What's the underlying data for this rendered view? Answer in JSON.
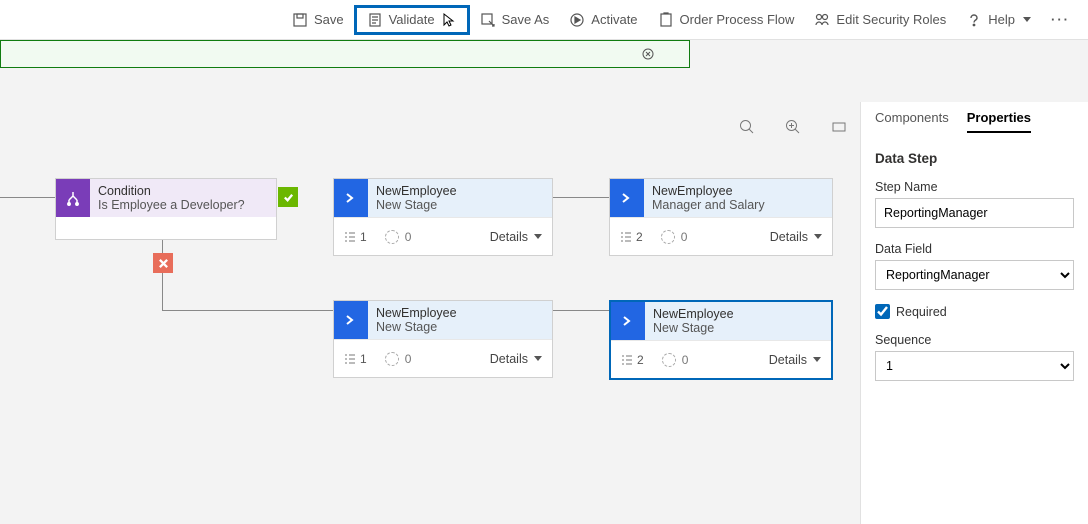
{
  "toolbar": {
    "save": "Save",
    "validate": "Validate",
    "saveAs": "Save As",
    "activate": "Activate",
    "processFlow": "Order Process Flow",
    "securityRoles": "Edit Security Roles",
    "help": "Help"
  },
  "canvas": {
    "condition": {
      "title": "Condition",
      "sub": "Is Employee a Developer?"
    },
    "s1": {
      "title": "NewEmployee",
      "sub": "New Stage",
      "count": "1",
      "proc": "0",
      "details": "Details"
    },
    "s2": {
      "title": "NewEmployee",
      "sub": "Manager and Salary",
      "count": "2",
      "proc": "0",
      "details": "Details"
    },
    "s3": {
      "title": "NewEmployee",
      "sub": "New Stage",
      "count": "1",
      "proc": "0",
      "details": "Details"
    },
    "s4": {
      "title": "NewEmployee",
      "sub": "New Stage",
      "count": "2",
      "proc": "0",
      "details": "Details"
    }
  },
  "panel": {
    "tabComponents": "Components",
    "tabProperties": "Properties",
    "heading": "Data Step",
    "stepNameLabel": "Step Name",
    "stepNameValue": "ReportingManager",
    "dataFieldLabel": "Data Field",
    "dataFieldValue": "ReportingManager",
    "requiredLabel": "Required",
    "requiredChecked": true,
    "sequenceLabel": "Sequence",
    "sequenceValue": "1"
  }
}
